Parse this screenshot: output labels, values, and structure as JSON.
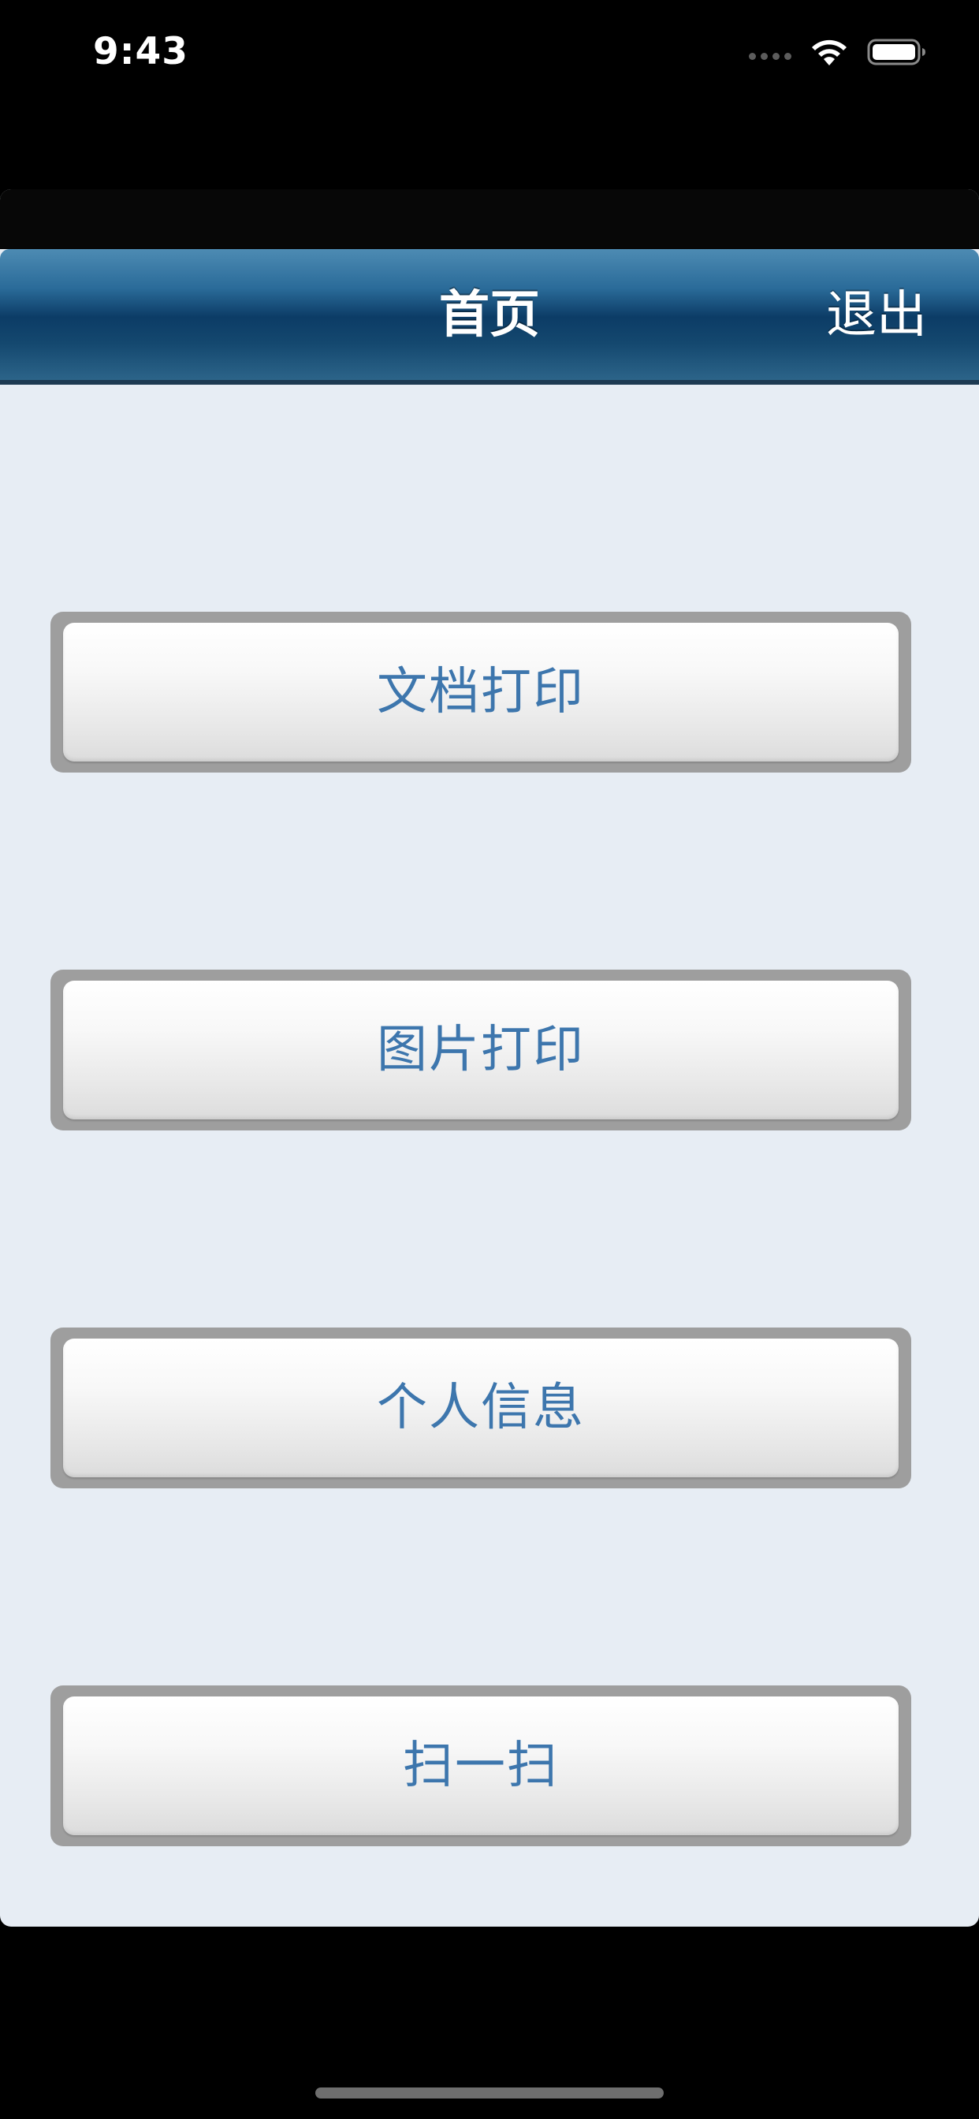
{
  "status_bar": {
    "time": "9:43",
    "icons": [
      "cellular-signal-icon",
      "wifi-icon",
      "battery-icon"
    ]
  },
  "nav": {
    "title": "首页",
    "logout_label": "退出"
  },
  "menu": {
    "items": [
      {
        "label": "文档打印"
      },
      {
        "label": "图片打印"
      },
      {
        "label": "个人信息"
      },
      {
        "label": "扫一扫"
      }
    ]
  },
  "colors": {
    "background": "#e7edf4",
    "nav_bar": "#0c3c66",
    "button_text": "#3d76ad",
    "button_border": "#9e9e9e"
  }
}
